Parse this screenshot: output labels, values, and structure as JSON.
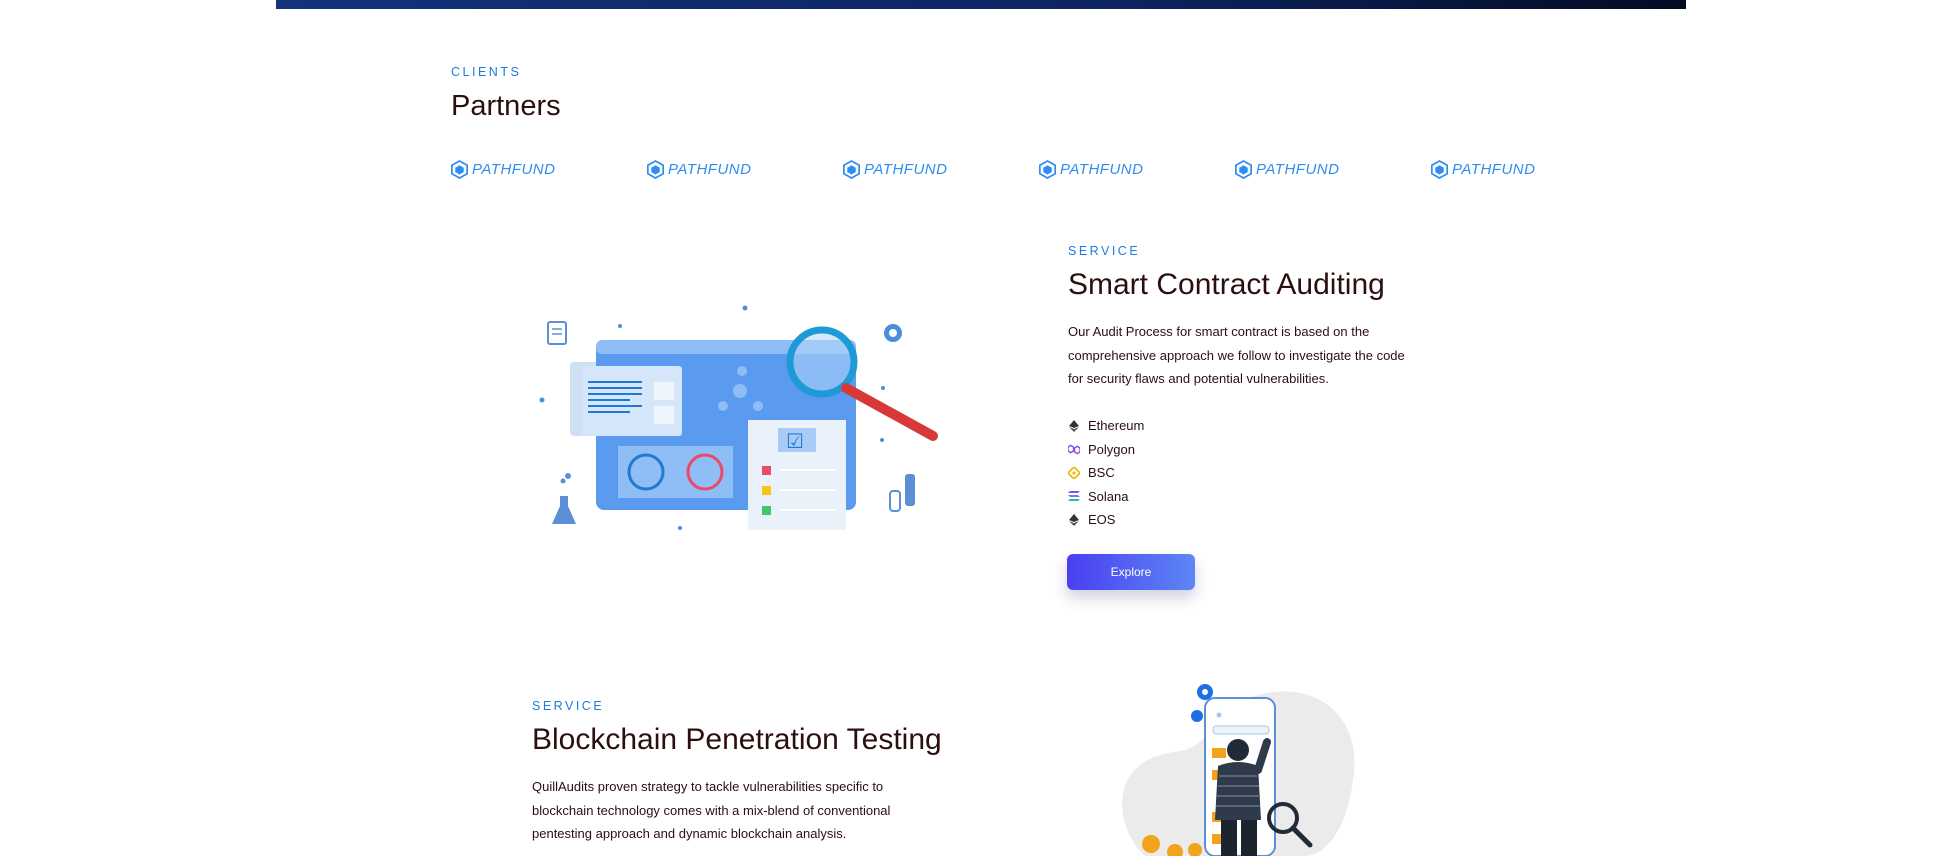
{
  "clients": {
    "eyebrow": "CLIENTS",
    "title": "Partners",
    "logos": [
      {
        "name": "PATHFUND"
      },
      {
        "name": "PATHFUND"
      },
      {
        "name": "PATHFUND"
      },
      {
        "name": "PATHFUND"
      },
      {
        "name": "PATHFUND"
      },
      {
        "name": "PATHFUND"
      }
    ]
  },
  "service1": {
    "eyebrow": "SERVICE",
    "title": "Smart Contract Auditing",
    "description": "Our Audit Process for smart contract is based on the comprehensive approach we follow to investigate the code for security flaws and potential vulnerabilities.",
    "chains": [
      {
        "label": "Ethereum",
        "icon": "ethereum-icon"
      },
      {
        "label": "Polygon",
        "icon": "polygon-icon"
      },
      {
        "label": "BSC",
        "icon": "bsc-icon"
      },
      {
        "label": "Solana",
        "icon": "solana-icon"
      },
      {
        "label": "EOS",
        "icon": "eos-icon"
      }
    ],
    "button_label": "Explore"
  },
  "service2": {
    "eyebrow": "SERVICE",
    "title": "Blockchain Penetration Testing",
    "description": "QuillAudits proven strategy to tackle vulnerabilities specific to blockchain technology comes with a mix-blend of conventional pentesting approach and dynamic blockchain analysis."
  },
  "colors": {
    "accent": "#1d7be0",
    "heading": "#2b0f0f",
    "button_start": "#4a3ff0",
    "button_end": "#5d86f5",
    "top_bar": "#13337a"
  }
}
